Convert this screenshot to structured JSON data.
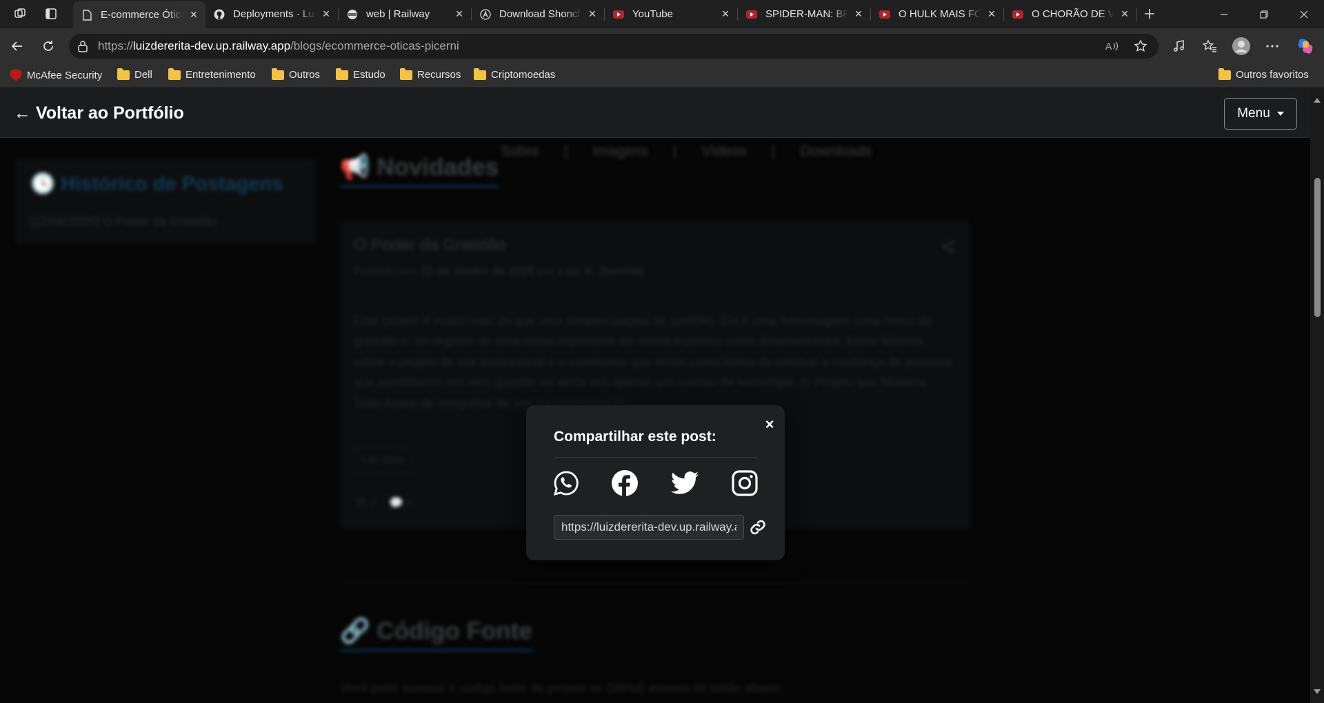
{
  "browser": {
    "tabs": [
      {
        "title": "E-commerce Óticas Picerni",
        "icon": "page-icon",
        "active": true
      },
      {
        "title": "Deployments · Luiz",
        "icon": "github-icon",
        "active": false
      },
      {
        "title": "web | Railway",
        "icon": "railway-icon",
        "active": false
      },
      {
        "title": "Download Shoncl",
        "icon": "a-circle-icon",
        "active": false
      },
      {
        "title": "YouTube",
        "icon": "youtube-icon",
        "active": false
      },
      {
        "title": "SPIDER-MAN: BRA",
        "icon": "youtube-icon",
        "active": false
      },
      {
        "title": "O HULK MAIS FOR",
        "icon": "youtube-icon",
        "active": false
      },
      {
        "title": "O CHORÃO DE VI",
        "icon": "youtube-icon",
        "active": false
      }
    ],
    "url": {
      "prefix": "https://",
      "domain": "luizdererita-dev.up.railway.app",
      "path": "/blogs/ecommerce-oticas-picerni"
    },
    "bookmarks": [
      {
        "label": "McAfee Security",
        "type": "mcafee"
      },
      {
        "label": "Dell",
        "type": "folder"
      },
      {
        "label": "Entretenimento",
        "type": "folder"
      },
      {
        "label": "Outros",
        "type": "folder"
      },
      {
        "label": "Estudo",
        "type": "folder"
      },
      {
        "label": "Recursos",
        "type": "folder"
      },
      {
        "label": "Criptomoedas",
        "type": "folder"
      }
    ],
    "other_favorites": "Outros favoritos"
  },
  "site": {
    "back_link": "← Voltar ao Portfólio",
    "menu_label": "Menu",
    "sub_nav": [
      "Sobre",
      "|",
      "Imagens",
      "|",
      "Vídeos",
      "|",
      "Downloads"
    ],
    "history_title": "🕓 Histórico de Postagens",
    "history_item": "[12/06/2025] O Poder da Gratidão",
    "news_title": "📢 Novidades",
    "post": {
      "title": "O Poder da Gratidão",
      "meta_prefix": "Postado em",
      "date": "12 de Junho de 2025",
      "meta_by": "por",
      "author": "Luiz K. Dererita",
      "excerpt": "Este projeto é muito mais do que uma simples página de portfólio. Ele é uma homenagem, uma forma de gratidão e um registro de uma etapa importante da minha trajetória como desenvolvedor. Estou falando sobre o projeto de site institucional e e-commerce que iniciei como forma de retribuir a confiança de pessoas que acreditaram em mim quando eu ainda era apenas um curioso da tecnologia. O Projeto que Mudaria Tudo Antes de mergulhar de vez na programação...",
      "read_more": "Ler mais",
      "views": "👁 2",
      "comments": "💬 0"
    },
    "code_title": "🔗 Código Fonte",
    "code_text": "Você pode acessar o código fonte do projeto no GitHub através do botão abaixo:"
  },
  "modal": {
    "title": "Compartilhar este post:",
    "close": "×",
    "share_url": "https://luizdererita-dev.up.railway.app/blogs/ecommerce-oticas-picerni",
    "socials": [
      "whatsapp-icon",
      "facebook-icon",
      "twitter-icon",
      "instagram-icon"
    ]
  }
}
